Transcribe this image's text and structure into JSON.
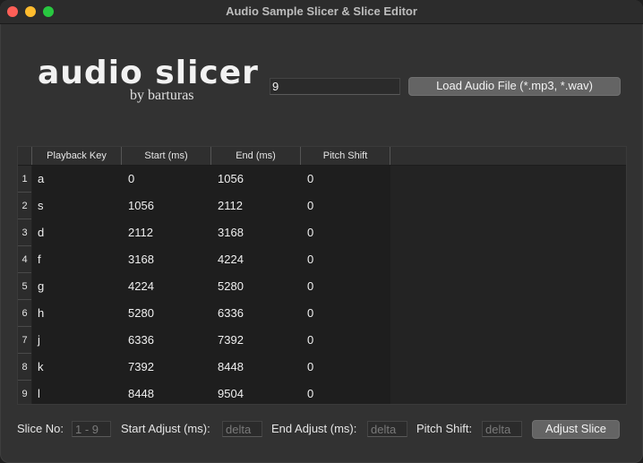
{
  "window": {
    "title": "Audio Sample Slicer & Slice Editor"
  },
  "logo": {
    "main": "audio slicer",
    "sub": "by barturas"
  },
  "top": {
    "slices_value": "9",
    "load_button": "Load Audio File (*.mp3, *.wav)"
  },
  "table": {
    "headers": [
      "Playback Key",
      "Start (ms)",
      "End (ms)",
      "Pitch Shift"
    ],
    "rows": [
      {
        "num": "1",
        "key": "a",
        "start": "0",
        "end": "1056",
        "pitch": "0"
      },
      {
        "num": "2",
        "key": "s",
        "start": "1056",
        "end": "2112",
        "pitch": "0"
      },
      {
        "num": "3",
        "key": "d",
        "start": "2112",
        "end": "3168",
        "pitch": "0"
      },
      {
        "num": "4",
        "key": "f",
        "start": "3168",
        "end": "4224",
        "pitch": "0"
      },
      {
        "num": "5",
        "key": "g",
        "start": "4224",
        "end": "5280",
        "pitch": "0"
      },
      {
        "num": "6",
        "key": "h",
        "start": "5280",
        "end": "6336",
        "pitch": "0"
      },
      {
        "num": "7",
        "key": "j",
        "start": "6336",
        "end": "7392",
        "pitch": "0"
      },
      {
        "num": "8",
        "key": "k",
        "start": "7392",
        "end": "8448",
        "pitch": "0"
      },
      {
        "num": "9",
        "key": "l",
        "start": "8448",
        "end": "9504",
        "pitch": "0"
      }
    ]
  },
  "bottom": {
    "slice_no_label": "Slice No:",
    "slice_no_placeholder": "1 - 9",
    "start_adjust_label": "Start Adjust (ms):",
    "start_adjust_placeholder": "delta",
    "end_adjust_label": "End Adjust (ms):",
    "end_adjust_placeholder": "delta",
    "pitch_shift_label": "Pitch Shift:",
    "pitch_shift_placeholder": "delta",
    "adjust_button": "Adjust Slice"
  },
  "colors": {
    "close": "#fe5f57",
    "minimize": "#febc2e",
    "maximize": "#28c840",
    "button": "#646464",
    "background": "#323232"
  }
}
